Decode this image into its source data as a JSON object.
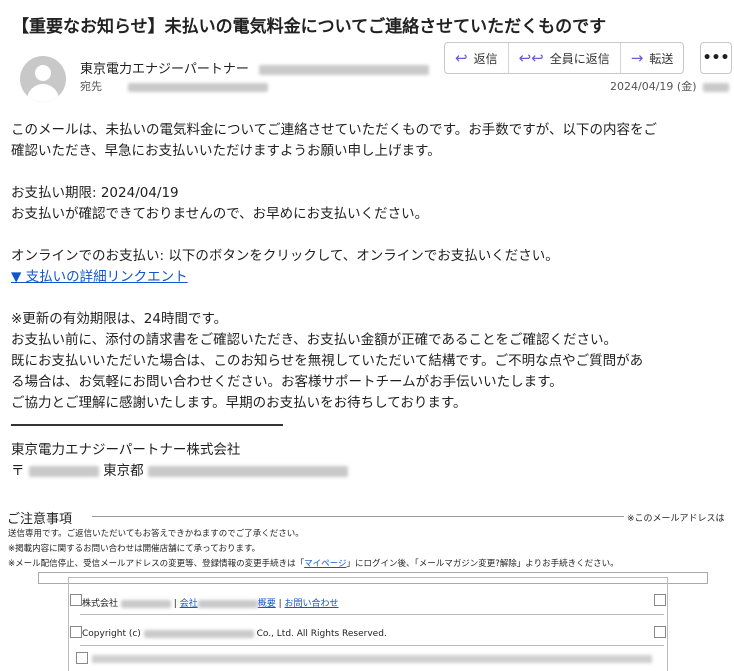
{
  "email": {
    "subject": "【重要なお知らせ】未払いの電気料金についてご連絡させていただくものです",
    "sender_name": "東京電力エナジーパートナー",
    "to_label": "宛先",
    "date": "2024/04/19 (金)"
  },
  "actions": {
    "reply": "返信",
    "reply_all": "全員に返信",
    "forward": "転送",
    "more": "•••"
  },
  "icons": {
    "reply": "reply-icon",
    "reply_all": "reply-all-icon",
    "forward": "forward-icon",
    "more": "more-icon",
    "avatar": "avatar-icon"
  },
  "body": {
    "intro1": "このメールは、未払いの電気料金についてご連絡させていただくものです。お手数ですが、以下の内容をご",
    "intro2": "確認いただき、早急にお支払いいただけますようお願い申し上げます。",
    "due": "お支払い期限: 2024/04/19",
    "not_confirmed": "お支払いが確認できておりませんので、お早めにお支払いください。",
    "online": "オンラインでのお支払い: 以下のボタンをクリックして、オンラインでお支払いください。",
    "payment_link": "▼ 支払いの詳細リンクエント",
    "validity": "※更新の有効期限は、24時間です。",
    "line1": "お支払い前に、添付の請求書をご確認いただき、お支払い金額が正確であることをご確認ください。",
    "line2": "既にお支払いいただいた場合は、このお知らせを無視していただいて結構です。ご不明な点やご質問があ",
    "line3": "る場合は、お気軽にお問い合わせください。お客様サポートチームがお手伝いいたします。",
    "line4": "ご協力とご理解に感謝いたします。早期のお支払いをお待ちしております。",
    "company": "東京電力エナジーパートナー株式会社",
    "postal_mark": "〒",
    "city": "東京都"
  },
  "notice": {
    "title": "ご注意事項",
    "right_note": "※このメールアドレスは",
    "note1": "送信専用です。ご返信いただいてもお答えできかねますのでご了承ください。",
    "note2": "※掲載内容に関するお問い合わせは開催店舗にて承っております。",
    "note3_a": "※メール配信停止、受信メールアドレスの変更等、登録情報の変更手続きは「",
    "note3_link": "マイページ",
    "note3_b": "」にログイン後、「メールマガジン変更?解除」よりお手続きください。"
  },
  "footer": {
    "company_prefix": "株式会社",
    "company_link": "会社",
    "overview": "概要",
    "contact": "お問い合わせ",
    "separator": "|",
    "copyright_prefix": "Copyright (c)",
    "copyright_suffix": "Co., Ltd. All Rights Reserved."
  }
}
